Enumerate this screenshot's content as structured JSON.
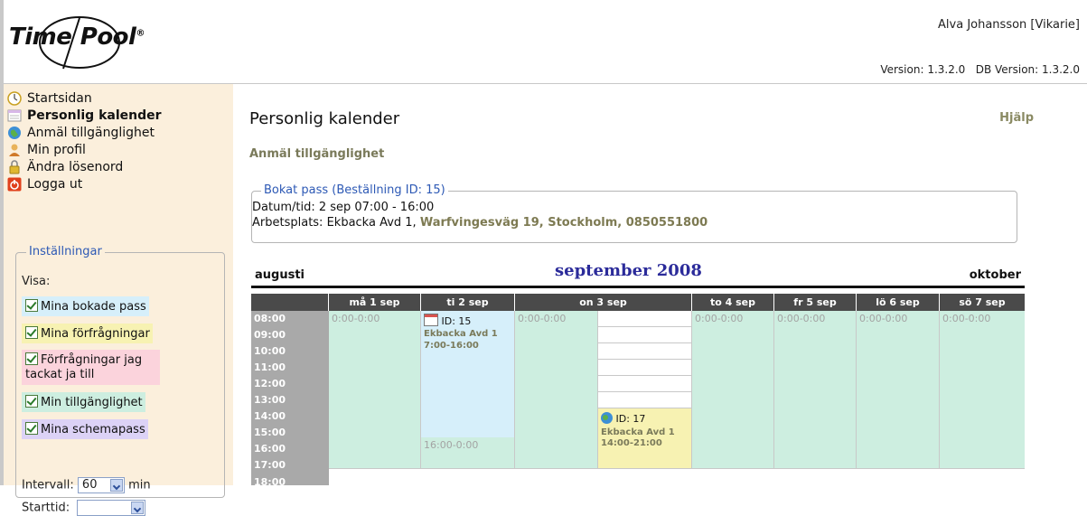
{
  "header": {
    "logo_text": "Time|Pool",
    "user": "Alva Johansson [Vikarie]",
    "version": "Version: 1.3.2.0   DB Version: 1.3.2.0"
  },
  "sidebar": {
    "items": [
      {
        "label": "Startsidan",
        "icon": "clock-icon"
      },
      {
        "label": "Personlig kalender",
        "icon": "calendar-icon"
      },
      {
        "label": "Anmäl tillgänglighet",
        "icon": "globe-icon"
      },
      {
        "label": "Min profil",
        "icon": "user-icon"
      },
      {
        "label": "Ändra lösenord",
        "icon": "lock-icon"
      },
      {
        "label": "Logga ut",
        "icon": "power-icon"
      }
    ],
    "settings": {
      "title": "Inställningar",
      "visa": "Visa:",
      "checkboxes": [
        {
          "label": "Mina bokade pass",
          "color": "#d6effa"
        },
        {
          "label": "Mina förfrågningar",
          "color": "#f7f2b2"
        },
        {
          "label": "Förfrågningar jag tackat ja till",
          "color": "#fbd3dc"
        },
        {
          "label": "Min tillgänglighet",
          "color": "#cdeee0"
        },
        {
          "label": "Mina schemapass",
          "color": "#dcd2f6"
        }
      ],
      "intervall_label": "Intervall:",
      "intervall_value": "60",
      "intervall_unit": "min",
      "starttid_label": "Starttid:"
    }
  },
  "main": {
    "title": "Personlig kalender",
    "help": "Hjälp",
    "anmal_link": "Anmäl tillgänglighet",
    "booked": {
      "legend": "Bokat pass (Beställning ID: 15)",
      "datetime": "Datum/tid: 2 sep 07:00 - 16:00",
      "workplace_prefix": "Arbetsplats: Ekbacka Avd 1, ",
      "address": "Warfvingesväg 19, Stockholm, 0850551800"
    },
    "calendar": {
      "prev_month": "augusti",
      "current_month": "september 2008",
      "next_month": "oktober",
      "days": [
        "må 1 sep",
        "ti 2 sep",
        "on 3 sep",
        "to 4 sep",
        "fr 5 sep",
        "lö 6 sep",
        "sö 7 sep"
      ],
      "times": [
        "08:00",
        "09:00",
        "10:00",
        "11:00",
        "12:00",
        "13:00",
        "14:00",
        "15:00",
        "16:00",
        "17:00",
        "18:00"
      ],
      "avail_text": "0:00-0:00",
      "avail_text_after": "16:00-0:00",
      "events": [
        {
          "id": "ID: 15",
          "place": "Ekbacka Avd 1",
          "time": "7:00-16:00",
          "color": "#d6effa"
        },
        {
          "id": "ID: 17",
          "place": "Ekbacka Avd 1",
          "time": "14:00-21:00",
          "color": "#f7f2b2"
        }
      ]
    }
  }
}
